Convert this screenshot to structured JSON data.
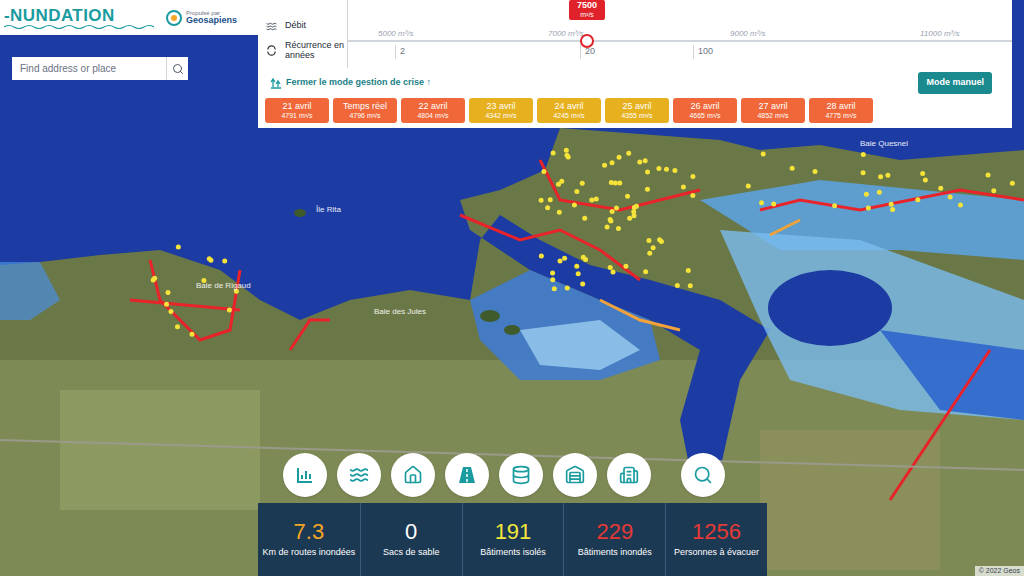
{
  "app": {
    "logo": "-NUNDATION",
    "powered_by": "Propulsé par",
    "brand": "Geosapiens"
  },
  "search": {
    "placeholder": "Find address or place"
  },
  "controls": {
    "flow": {
      "label": "Débit",
      "ticks": [
        "5000 m³/s",
        "7000 m³/s",
        "9000 m³/s",
        "11000 m³/s"
      ],
      "value": "7500",
      "unit": "m³/s",
      "level": 0.36
    },
    "recurrence": {
      "label": "Récurrence en années",
      "ticks": [
        "2",
        "20",
        "100"
      ]
    },
    "crisis_link": "Fermer le mode gestion de crise ↑",
    "manual_button": "Mode manuel"
  },
  "forecasts": [
    {
      "date": "21 avril",
      "flow": "4791 m³/s",
      "color": "#f0683a"
    },
    {
      "date": "Temps réel",
      "flow": "4796 m³/s",
      "color": "#f0683a"
    },
    {
      "date": "22 avril",
      "flow": "4804 m³/s",
      "color": "#f0683a"
    },
    {
      "date": "23 avril",
      "flow": "4342 m³/s",
      "color": "#e6b01e"
    },
    {
      "date": "24 avril",
      "flow": "4245 m³/s",
      "color": "#e6b01e"
    },
    {
      "date": "25 avril",
      "flow": "4355 m³/s",
      "color": "#e6b01e"
    },
    {
      "date": "26 avril",
      "flow": "4665 m³/s",
      "color": "#f0683a"
    },
    {
      "date": "27 avril",
      "flow": "4852 m³/s",
      "color": "#f0683a"
    },
    {
      "date": "28 avril",
      "flow": "4775 m³/s",
      "color": "#f0683a"
    }
  ],
  "map_labels": [
    "Île Rita",
    "Baie de Rigaud",
    "Baie des Jules",
    "Baie Quesnel"
  ],
  "stats": [
    {
      "value": "7.3",
      "label": "Km de routes inondées",
      "color": "#f5a623"
    },
    {
      "value": "0",
      "label": "Sacs de sable",
      "color": "#ffffff"
    },
    {
      "value": "191",
      "label": "Bâtiments isolés",
      "color": "#f3e53c"
    },
    {
      "value": "229",
      "label": "Bâtiments inondés",
      "color": "#e53935"
    },
    {
      "value": "1256",
      "label": "Personnes à évacuer",
      "color": "#e53935"
    }
  ],
  "attribution": "© 2022 Geos"
}
